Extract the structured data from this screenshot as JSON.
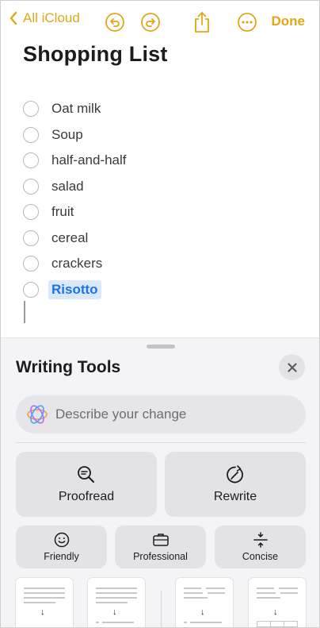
{
  "header": {
    "back_label": "All iCloud",
    "done_label": "Done"
  },
  "note": {
    "title": "Shopping List",
    "items": [
      "Oat milk",
      "Soup",
      "half-and-half",
      "salad",
      "fruit",
      "cereal",
      "crackers",
      "Risotto"
    ]
  },
  "writing_tools": {
    "title": "Writing Tools",
    "describe_placeholder": "Describe your change",
    "proofread_label": "Proofread",
    "rewrite_label": "Rewrite",
    "friendly_label": "Friendly",
    "professional_label": "Professional",
    "concise_label": "Concise"
  },
  "colors": {
    "accent": "#e3a617",
    "selection": "#d9e8fb",
    "selection_text": "#1a73e8"
  }
}
